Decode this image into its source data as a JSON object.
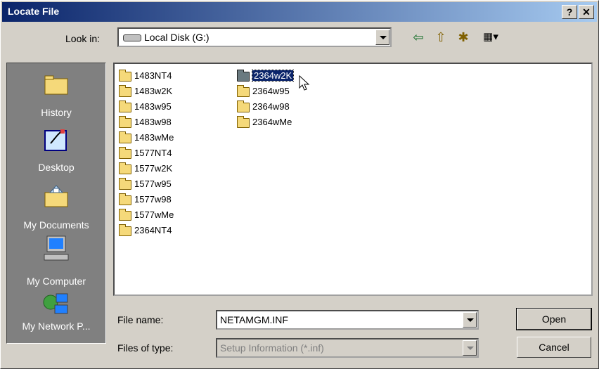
{
  "window": {
    "title": "Locate File",
    "help_label": "?",
    "close_label": "✕"
  },
  "lookin": {
    "label": "Look in:",
    "value": "Local Disk (G:)"
  },
  "toolbar": {
    "back_icon": "⇦",
    "up_icon": "⇧",
    "newfolder_icon": "✱",
    "views_icon": "▦▾"
  },
  "places": [
    {
      "label": "History",
      "icon": "history-icon"
    },
    {
      "label": "Desktop",
      "icon": "desktop-icon"
    },
    {
      "label": "My Documents",
      "icon": "my-documents-icon"
    },
    {
      "label": "My Computer",
      "icon": "my-computer-icon"
    },
    {
      "label": "My Network P...",
      "icon": "network-places-icon"
    }
  ],
  "files": {
    "col1": [
      "1483NT4",
      "1483w2K",
      "1483w95",
      "1483w98",
      "1483wMe",
      "1577NT4",
      "1577w2K",
      "1577w95",
      "1577w98",
      "1577wMe",
      "2364NT4"
    ],
    "col2": [
      "2364w2K",
      "2364w95",
      "2364w98",
      "2364wMe"
    ],
    "selected": "2364w2K"
  },
  "filename": {
    "label": "File name:",
    "value": "NETAMGM.INF"
  },
  "filetype": {
    "label": "Files of type:",
    "value": "Setup Information (*.inf)"
  },
  "buttons": {
    "open": "Open",
    "cancel": "Cancel"
  },
  "colors": {
    "title_start": "#0a246a",
    "title_end": "#a6caf0",
    "dialog_bg": "#d4d0c8",
    "places_bg": "#808080",
    "selection": "#0a246a"
  }
}
